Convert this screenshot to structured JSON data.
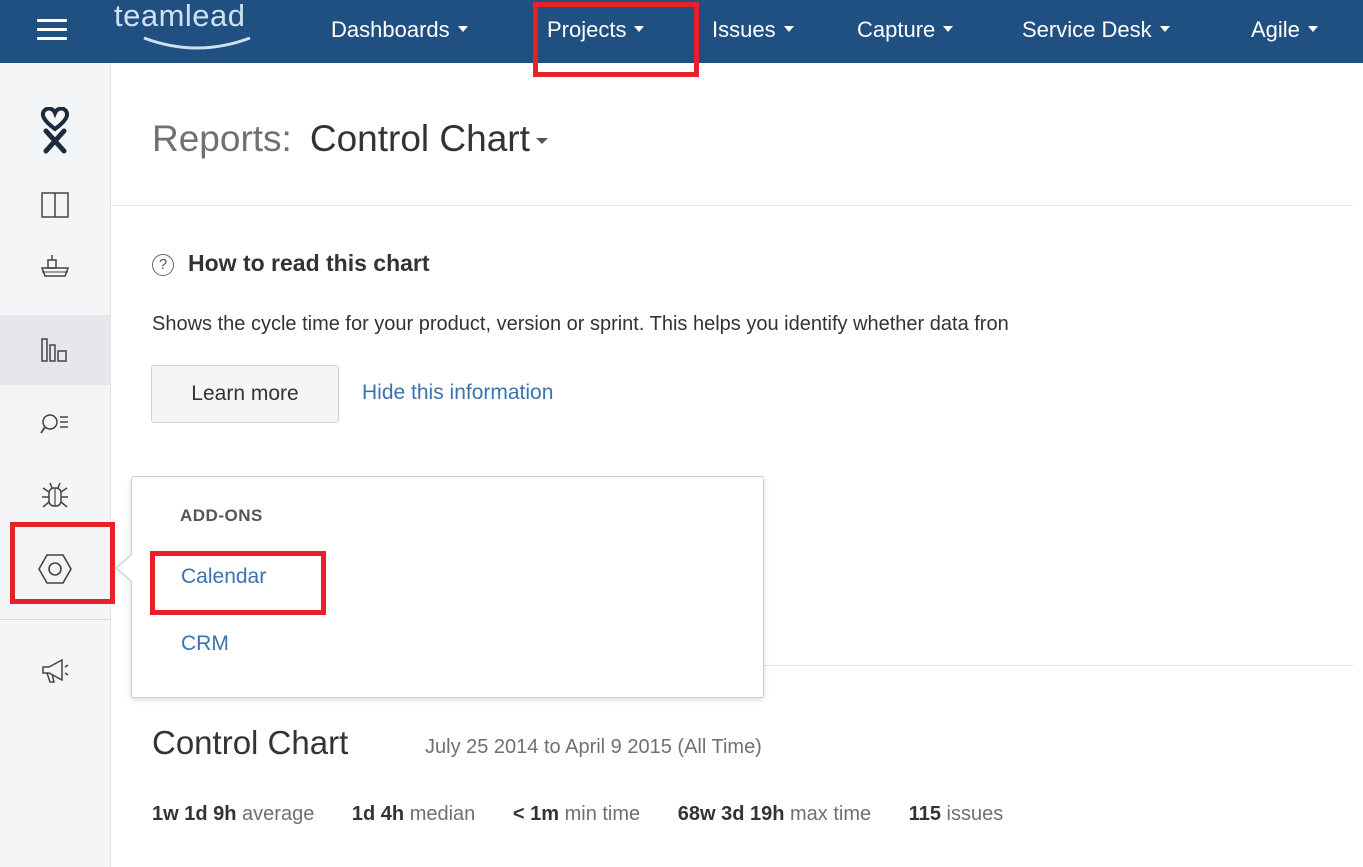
{
  "topbar": {
    "logo_text": "teamlead",
    "nav": [
      {
        "label": "Dashboards"
      },
      {
        "label": "Projects"
      },
      {
        "label": "Issues"
      },
      {
        "label": "Capture"
      },
      {
        "label": "Service Desk"
      },
      {
        "label": "Agile"
      }
    ],
    "highlighted_item": "Projects"
  },
  "sidebar": {
    "icons": [
      "project-avatar-icon",
      "board-icon",
      "backlog-icon",
      "reports-icon",
      "issue-search-icon",
      "bug-icon",
      "add-ons-icon",
      "feedback-icon"
    ],
    "active_icon": "reports-icon",
    "highlighted_icon": "add-ons-icon"
  },
  "header": {
    "prefix": "Reports:",
    "title": "Control Chart"
  },
  "info": {
    "heading": "How to read this chart",
    "description": "Shows the cycle time for your product, version or sprint. This helps you identify whether data fron",
    "learn_more": "Learn more",
    "hide": "Hide this information"
  },
  "addons_menu": {
    "heading": "ADD-ONS",
    "items": [
      {
        "label": "Calendar"
      },
      {
        "label": "CRM"
      }
    ],
    "highlighted_item": "Calendar"
  },
  "control_chart": {
    "title": "Control Chart",
    "range": "July 25 2014 to April 9 2015 (All Time)",
    "stats": [
      {
        "value": "1w 1d 9h",
        "label": "average"
      },
      {
        "value": "1d 4h",
        "label": "median"
      },
      {
        "value": "< 1m",
        "label": "min time"
      },
      {
        "value": "68w 3d 19h",
        "label": "max time"
      },
      {
        "value": "115",
        "label": "issues"
      }
    ]
  },
  "colors": {
    "topbar": "#205081",
    "link": "#3b73af",
    "highlight": "#e8202a"
  }
}
